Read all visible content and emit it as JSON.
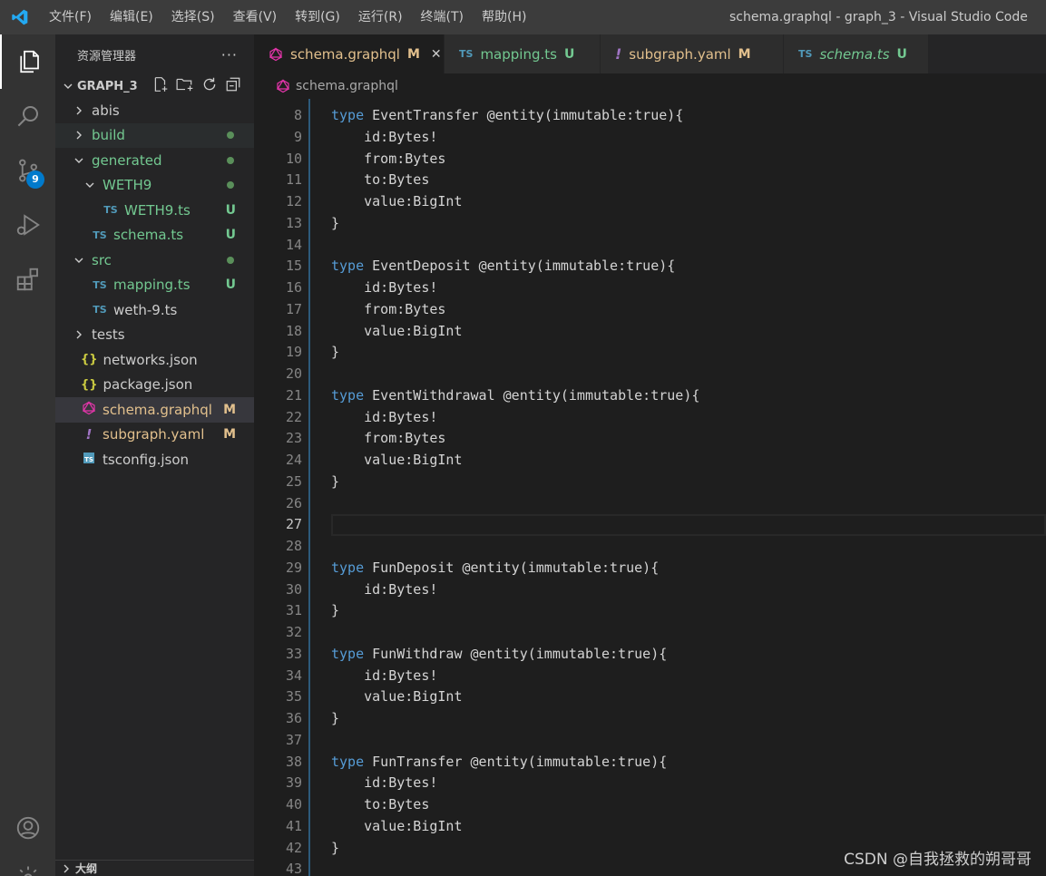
{
  "titlebar": {
    "menu": [
      "文件(F)",
      "编辑(E)",
      "选择(S)",
      "查看(V)",
      "转到(G)",
      "运行(R)",
      "终端(T)",
      "帮助(H)"
    ],
    "window_title": "schema.graphql - graph_3 - Visual Studio Code"
  },
  "activitybar": {
    "scm_badge": "9"
  },
  "sidebar": {
    "title": "资源管理器",
    "more": "···",
    "section": "GRAPH_3",
    "outline": "大纲",
    "tree": [
      {
        "label": "abis",
        "indent": 0,
        "type": "folder",
        "expanded": false,
        "color": "#cccccc"
      },
      {
        "label": "build",
        "indent": 0,
        "type": "folder",
        "expanded": false,
        "color": "#73c991",
        "dot": true
      },
      {
        "label": "generated",
        "indent": 0,
        "type": "folder",
        "expanded": true,
        "color": "#73c991",
        "dot": true
      },
      {
        "label": "WETH9",
        "indent": 1,
        "type": "folder",
        "expanded": true,
        "color": "#73c991",
        "dot": true
      },
      {
        "label": "WETH9.ts",
        "indent": 2,
        "type": "ts",
        "color": "#73c991",
        "status": "U"
      },
      {
        "label": "schema.ts",
        "indent": 1,
        "type": "ts",
        "color": "#73c991",
        "status": "U"
      },
      {
        "label": "src",
        "indent": 0,
        "type": "folder",
        "expanded": true,
        "color": "#73c991",
        "dot": true
      },
      {
        "label": "mapping.ts",
        "indent": 1,
        "type": "ts",
        "color": "#73c991",
        "status": "U"
      },
      {
        "label": "weth-9.ts",
        "indent": 1,
        "type": "ts",
        "color": "#cccccc"
      },
      {
        "label": "tests",
        "indent": 0,
        "type": "folder",
        "expanded": false,
        "color": "#cccccc"
      },
      {
        "label": "networks.json",
        "indent": 0,
        "type": "json",
        "color": "#cccccc"
      },
      {
        "label": "package.json",
        "indent": 0,
        "type": "json",
        "color": "#cccccc"
      },
      {
        "label": "schema.graphql",
        "indent": 0,
        "type": "graphql",
        "color": "#e2c08d",
        "status": "M",
        "selected": true
      },
      {
        "label": "subgraph.yaml",
        "indent": 0,
        "type": "yaml",
        "color": "#e2c08d",
        "status": "M"
      },
      {
        "label": "tsconfig.json",
        "indent": 0,
        "type": "tsconfig",
        "color": "#cccccc"
      }
    ]
  },
  "tabs": [
    {
      "label": "schema.graphql",
      "mark": "M",
      "type": "graphql",
      "active": true,
      "color": "#e2c08d",
      "close": "✕"
    },
    {
      "label": "mapping.ts",
      "mark": "U",
      "type": "ts",
      "active": false,
      "color": "#73c991"
    },
    {
      "label": "subgraph.yaml",
      "mark": "M",
      "type": "yaml",
      "active": false,
      "color": "#e2c08d"
    },
    {
      "label": "schema.ts",
      "mark": "U",
      "type": "ts",
      "active": false,
      "color": "#73c991",
      "italic": true
    }
  ],
  "breadcrumb": "schema.graphql",
  "editor": {
    "current_line": 27,
    "lines": [
      {
        "n": "8",
        "t": "type EventTransfer @entity(immutable:true){"
      },
      {
        "n": "9",
        "t": "    id:Bytes!"
      },
      {
        "n": "10",
        "t": "    from:Bytes"
      },
      {
        "n": "11",
        "t": "    to:Bytes"
      },
      {
        "n": "12",
        "t": "    value:BigInt"
      },
      {
        "n": "13",
        "t": "}"
      },
      {
        "n": "14",
        "t": ""
      },
      {
        "n": "15",
        "t": "type EventDeposit @entity(immutable:true){"
      },
      {
        "n": "16",
        "t": "    id:Bytes!"
      },
      {
        "n": "17",
        "t": "    from:Bytes"
      },
      {
        "n": "18",
        "t": "    value:BigInt"
      },
      {
        "n": "19",
        "t": "}"
      },
      {
        "n": "20",
        "t": ""
      },
      {
        "n": "21",
        "t": "type EventWithdrawal @entity(immutable:true){"
      },
      {
        "n": "22",
        "t": "    id:Bytes!"
      },
      {
        "n": "23",
        "t": "    from:Bytes"
      },
      {
        "n": "24",
        "t": "    value:BigInt"
      },
      {
        "n": "25",
        "t": "}"
      },
      {
        "n": "26",
        "t": ""
      },
      {
        "n": "27",
        "t": ""
      },
      {
        "n": "28",
        "t": ""
      },
      {
        "n": "29",
        "t": "type FunDeposit @entity(immutable:true){"
      },
      {
        "n": "30",
        "t": "    id:Bytes!"
      },
      {
        "n": "31",
        "t": "}"
      },
      {
        "n": "32",
        "t": ""
      },
      {
        "n": "33",
        "t": "type FunWithdraw @entity(immutable:true){"
      },
      {
        "n": "34",
        "t": "    id:Bytes!"
      },
      {
        "n": "35",
        "t": "    value:BigInt"
      },
      {
        "n": "36",
        "t": "}"
      },
      {
        "n": "37",
        "t": ""
      },
      {
        "n": "38",
        "t": "type FunTransfer @entity(immutable:true){"
      },
      {
        "n": "39",
        "t": "    id:Bytes!"
      },
      {
        "n": "40",
        "t": "    to:Bytes"
      },
      {
        "n": "41",
        "t": "    value:BigInt"
      },
      {
        "n": "42",
        "t": "}"
      },
      {
        "n": "43",
        "t": ""
      }
    ]
  },
  "watermark": "CSDN @自我拯救的朔哥哥",
  "colors": {
    "ts": "#519aba",
    "json": "#cbcb41",
    "graphql": "#e535ab",
    "yaml": "#a074c4",
    "accent": "#007acc"
  }
}
